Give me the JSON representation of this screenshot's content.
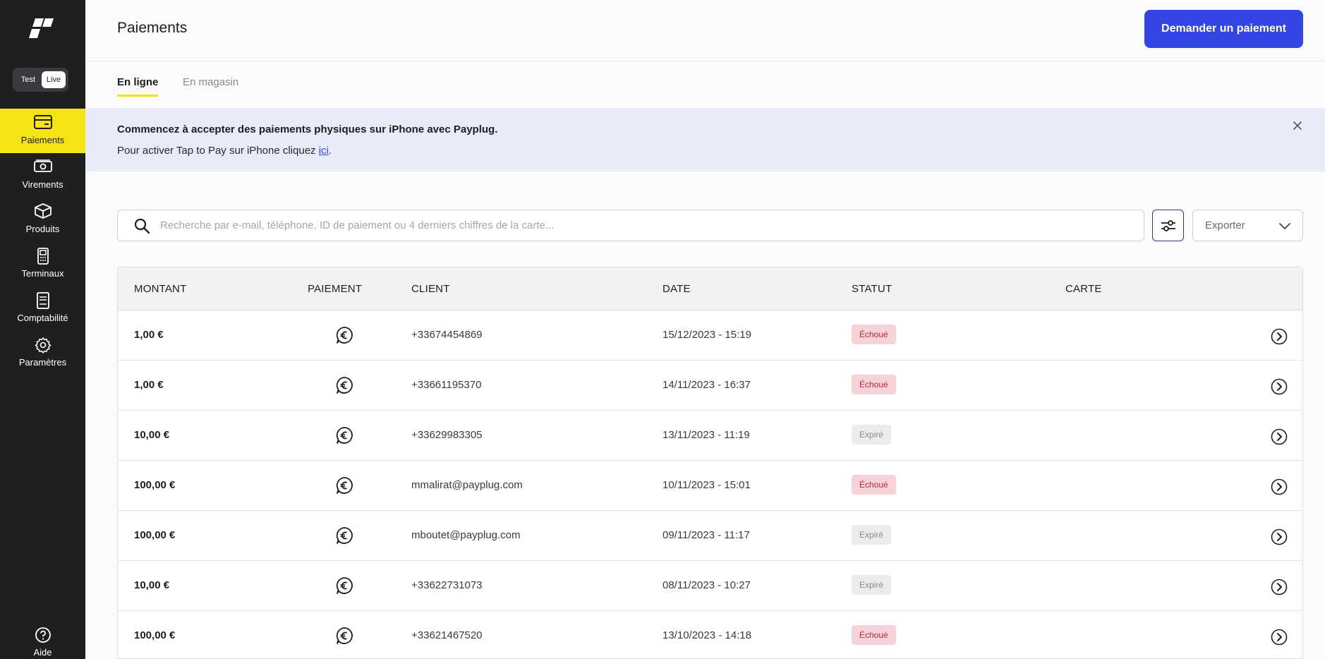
{
  "sidebar": {
    "mode": {
      "test": "Test",
      "live": "Live"
    },
    "items": [
      {
        "label": "Paiements",
        "icon": "card-icon",
        "active": true
      },
      {
        "label": "Virements",
        "icon": "banknote-icon",
        "active": false
      },
      {
        "label": "Produits",
        "icon": "box-icon",
        "active": false
      },
      {
        "label": "Terminaux",
        "icon": "terminal-icon",
        "active": false
      },
      {
        "label": "Comptabilité",
        "icon": "receipt-icon",
        "active": false
      },
      {
        "label": "Paramètres",
        "icon": "gear-icon",
        "active": false
      }
    ],
    "help_label": "Aide"
  },
  "header": {
    "title": "Paiements",
    "primary_button": "Demander un paiement"
  },
  "tabs": [
    {
      "label": "En ligne",
      "active": true
    },
    {
      "label": "En magasin",
      "active": false
    }
  ],
  "banner": {
    "title": "Commencez à accepter des paiements physiques sur iPhone avec Payplug.",
    "text_before": "Pour activer Tap to Pay sur iPhone cliquez ",
    "link": "ici",
    "text_after": "."
  },
  "search": {
    "placeholder": "Recherche par e-mail, téléphone, ID de paiement ou 4 derniers chiffres de la carte...",
    "value": ""
  },
  "export": {
    "label": "Exporter"
  },
  "table": {
    "columns": [
      "MONTANT",
      "PAIEMENT",
      "CLIENT",
      "DATE",
      "STATUT",
      "CARTE"
    ],
    "rows": [
      {
        "amount": "1,00 €",
        "client": "+33674454869",
        "date": "15/12/2023 - 15:19",
        "status": "Échoué"
      },
      {
        "amount": "1,00 €",
        "client": "+33661195370",
        "date": "14/11/2023 - 16:37",
        "status": "Échoué"
      },
      {
        "amount": "10,00 €",
        "client": "+33629983305",
        "date": "13/11/2023 - 11:19",
        "status": "Expiré"
      },
      {
        "amount": "100,00 €",
        "client": "mmalirat@payplug.com",
        "date": "10/11/2023 - 15:01",
        "status": "Échoué"
      },
      {
        "amount": "100,00 €",
        "client": "mboutet@payplug.com",
        "date": "09/11/2023 - 11:17",
        "status": "Expiré"
      },
      {
        "amount": "10,00 €",
        "client": "+33622731073",
        "date": "08/11/2023 - 10:27",
        "status": "Expiré"
      },
      {
        "amount": "100,00 €",
        "client": "+33621467520",
        "date": "13/10/2023 - 14:18",
        "status": "Échoué"
      }
    ]
  },
  "colors": {
    "sidebar_bg": "#1f1f22",
    "accent_yellow": "#f5e415",
    "primary_blue": "#3346e4",
    "banner_bg": "#e8ebf8",
    "failed_bg": "#f6d3d8",
    "failed_text": "#c0283b",
    "expired_bg": "#ececec",
    "expired_text": "#8b8b8b"
  }
}
